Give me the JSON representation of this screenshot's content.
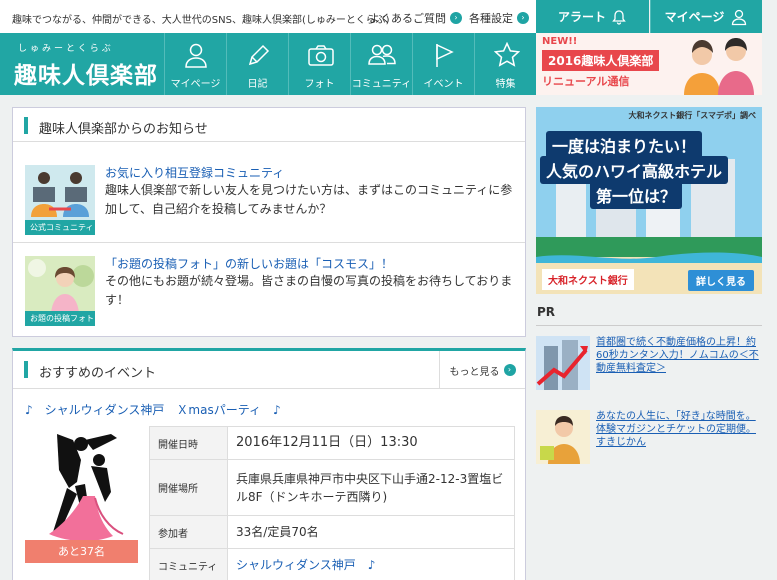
{
  "header": {
    "tagline": "趣味でつながる、仲間ができる、大人世代のSNS、趣味人倶楽部(しゅみーとくらぶ)",
    "faq_label": "よくあるご質問",
    "settings_label": "各種設定",
    "alert_label": "アラート",
    "mypage_label": "マイページ"
  },
  "logo": {
    "ruby": "しゅみーとくらぶ",
    "title": "趣味人倶楽部"
  },
  "nav": [
    {
      "label": "マイページ",
      "icon": "person-icon"
    },
    {
      "label": "日記",
      "icon": "pencil-icon"
    },
    {
      "label": "フォト",
      "icon": "camera-icon"
    },
    {
      "label": "コミュニティ",
      "icon": "people-icon"
    },
    {
      "label": "イベント",
      "icon": "flag-icon"
    },
    {
      "label": "特集",
      "icon": "star-icon"
    }
  ],
  "promo": {
    "new": "NEW!!",
    "year": "2016趣味人倶楽部",
    "sub": "リニューアル通信"
  },
  "notices": {
    "title": "趣味人倶楽部からのお知らせ",
    "items": [
      {
        "title": "お気に入り相互登録コミュニティ",
        "body": "趣味人倶楽部で新しい友人を見つけたい方は、まずはこのコミュニティに参加して、自己紹介を投稿してみませんか？",
        "tag": "公式コミュニティ"
      },
      {
        "title": "「お題の投稿フォト」の新しいお題は「コスモス」！",
        "body": "その他にもお題が続々登場。皆さまの自慢の写真の投稿をお待ちしております！",
        "tag": "お題の投稿フォト"
      }
    ]
  },
  "events": {
    "title": "おすすめのイベント",
    "more": "もっと見る",
    "event_title": "♪　シャルウィダンス神戸　Ｘmasパーティ　♪",
    "badge": "あと37名",
    "rows": [
      {
        "label": "開催日時",
        "value": "2016年12月11日（日）13:30"
      },
      {
        "label": "開催場所",
        "value": "兵庫県兵庫県神戸市中央区下山手通2-12-3置塩ビル8F（ドンキホーテ西隣り)"
      },
      {
        "label": "参加者",
        "value": "33名/定員70名"
      },
      {
        "label": "コミュニティ",
        "value": "シャルウィダンス神戸　♪"
      }
    ]
  },
  "ad": {
    "sponsor": "大和ネクスト銀行「スマデポ」調べ",
    "line1": "一度は泊まりたい！",
    "line2": "人気のハワイ高級ホテル",
    "line3": "第一位は？",
    "bank": "大和ネクスト銀行",
    "cta": "詳しく見る"
  },
  "pr": {
    "label": "PR",
    "items": [
      {
        "text": "首都圏で続く不動産価格の上昇！約60秒カンタン入力！ノムコムの＜不動産無料査定＞"
      },
      {
        "text": "あなたの人生に、｢好き｣な時間を。体験マガジンとチケットの定期便。すきじかん"
      }
    ]
  },
  "colors": {
    "brand": "#21a6a4",
    "accent": "#e8474c",
    "link": "#1a5fb4"
  }
}
